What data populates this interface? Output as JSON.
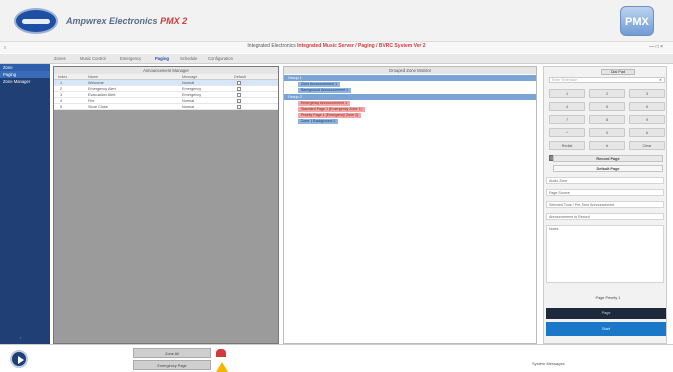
{
  "header": {
    "brand_main": "Ampwrex Electronics",
    "brand_accent": "PMX 2",
    "product_logo_text": "PMX"
  },
  "window": {
    "title_prefix": "Integrated Electronics",
    "title_highlight": "Integrated Music Server / Paging / BVRC System Ver 2",
    "controls": "— □ ×"
  },
  "menu": {
    "items": [
      "Zones",
      "Music Control",
      "Emergency",
      "Paging",
      "Schedule",
      "Configuration"
    ]
  },
  "sidebar": {
    "items": [
      {
        "label": "Zone"
      },
      {
        "label": "Paging"
      },
      {
        "label": "Zone Manager"
      }
    ]
  },
  "left_panel": {
    "title": "Announcement Manager",
    "columns": [
      "Index",
      "Name",
      "Message",
      "Default"
    ],
    "rows": [
      {
        "index": "1",
        "name": "Welcome",
        "type": "Normal"
      },
      {
        "index": "2",
        "name": "Emergency Alert",
        "type": "Emergency"
      },
      {
        "index": "3",
        "name": "Evacuation Alert",
        "type": "Emergency"
      },
      {
        "index": "4",
        "name": "Fire",
        "type": "Normal"
      },
      {
        "index": "5",
        "name": "Store Close",
        "type": "Normal"
      }
    ]
  },
  "mid_panel": {
    "title": "Grouped Zone Monitor",
    "groups": [
      {
        "label": "Group 1",
        "chips": [
          {
            "text": "Zone Announcement 1",
            "color": "blue"
          },
          {
            "text": "Background Announcement 1",
            "color": "blue"
          }
        ]
      },
      {
        "label": "Group 2",
        "chips": [
          {
            "text": "Emergency Announcement 1",
            "color": "red"
          },
          {
            "text": "Standard Page 1 (Emergency Zone 1)",
            "color": "red"
          },
          {
            "text": "Priority Page 1 (Emergency Zone 2)",
            "color": "red"
          },
          {
            "text": "Zone 1 Background 1",
            "color": "blue"
          }
        ]
      }
    ]
  },
  "right_panel": {
    "keypad_title": "Dial Pad",
    "keypad_placeholder": "Enter Extension",
    "keypad_clear": "✕",
    "keys": [
      "1",
      "2",
      "3",
      "4",
      "5",
      "6",
      "7",
      "8",
      "9",
      "*",
      "0",
      "#",
      "Redial",
      "#",
      "Clear"
    ],
    "record_page": "Record Page",
    "default_page": "Default Page",
    "fields": [
      "Audio Zone",
      "Page Source",
      "Selected Tone / Pre-Tone Announcement",
      "Announcement to Record"
    ],
    "notes_label": "Notes",
    "page_priority": "Page Priority  1",
    "dark_button": "Page",
    "blue_button": "Start"
  },
  "bottom": {
    "zone_btn": "Zone All",
    "emergency_btn": "Emergency Page",
    "system_messages": "System Messages"
  },
  "colors": {
    "accent_blue": "#1f3f75",
    "accent_red": "#d23b3b"
  }
}
